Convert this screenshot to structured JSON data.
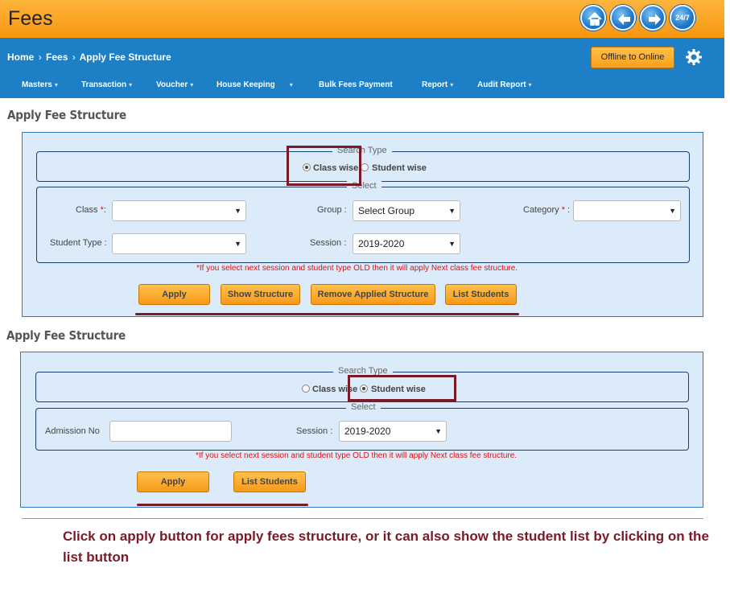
{
  "header": {
    "title": "Fees",
    "nav_icons": [
      "home-icon",
      "back-arrow-icon",
      "forward-arrow-icon",
      "support-24-7-icon"
    ],
    "support_label": "24/7"
  },
  "breadcrumb": {
    "items": [
      "Home",
      "Fees",
      "Apply Fee Structure"
    ],
    "separator": "›"
  },
  "offline_button": "Offline to Online",
  "menu": {
    "items": [
      "Masters",
      "Transaction",
      "Voucher",
      "House Keeping",
      "Bulk Fees Payment",
      "Report",
      "Audit Report"
    ],
    "caret": "▾"
  },
  "section1": {
    "title": "Apply Fee Structure",
    "search_type": {
      "legend": "Search Type",
      "options": [
        "Class wise",
        "Student wise"
      ],
      "selected": "Class wise"
    },
    "select": {
      "legend": "Select",
      "class_label": "Class",
      "group_label": "Group :",
      "group_value": "Select Group",
      "category_label": "Category",
      "student_type_label": "Student Type :",
      "session_label": "Session :",
      "session_value": "2019-2020",
      "required_mark": "*",
      "colon": ":"
    },
    "note": "*If you select next session and student type OLD then it will apply Next class fee structure.",
    "buttons": [
      "Apply",
      "Show Structure",
      "Remove Applied Structure",
      "List Students"
    ]
  },
  "section2": {
    "title": "Apply Fee Structure",
    "search_type": {
      "legend": "Search Type",
      "options": [
        "Class wise",
        "Student wise"
      ],
      "selected": "Student wise"
    },
    "select": {
      "legend": "Select",
      "admission_label": "Admission No",
      "admission_value": "",
      "session_label": "Session :",
      "session_value": "2019-2020"
    },
    "note": "*If you select next session and student type OLD then it will apply Next class fee structure.",
    "buttons": [
      "Apply",
      "List Students"
    ]
  },
  "caption": "Click on apply button for apply fees structure, or it can also show the student list by clicking on the list button",
  "colors": {
    "header_orange": "#f7960f",
    "nav_blue": "#1d80c6",
    "panel_bg": "#dbebfa",
    "highlight": "#7a1a26",
    "required_red": "#e01010"
  }
}
